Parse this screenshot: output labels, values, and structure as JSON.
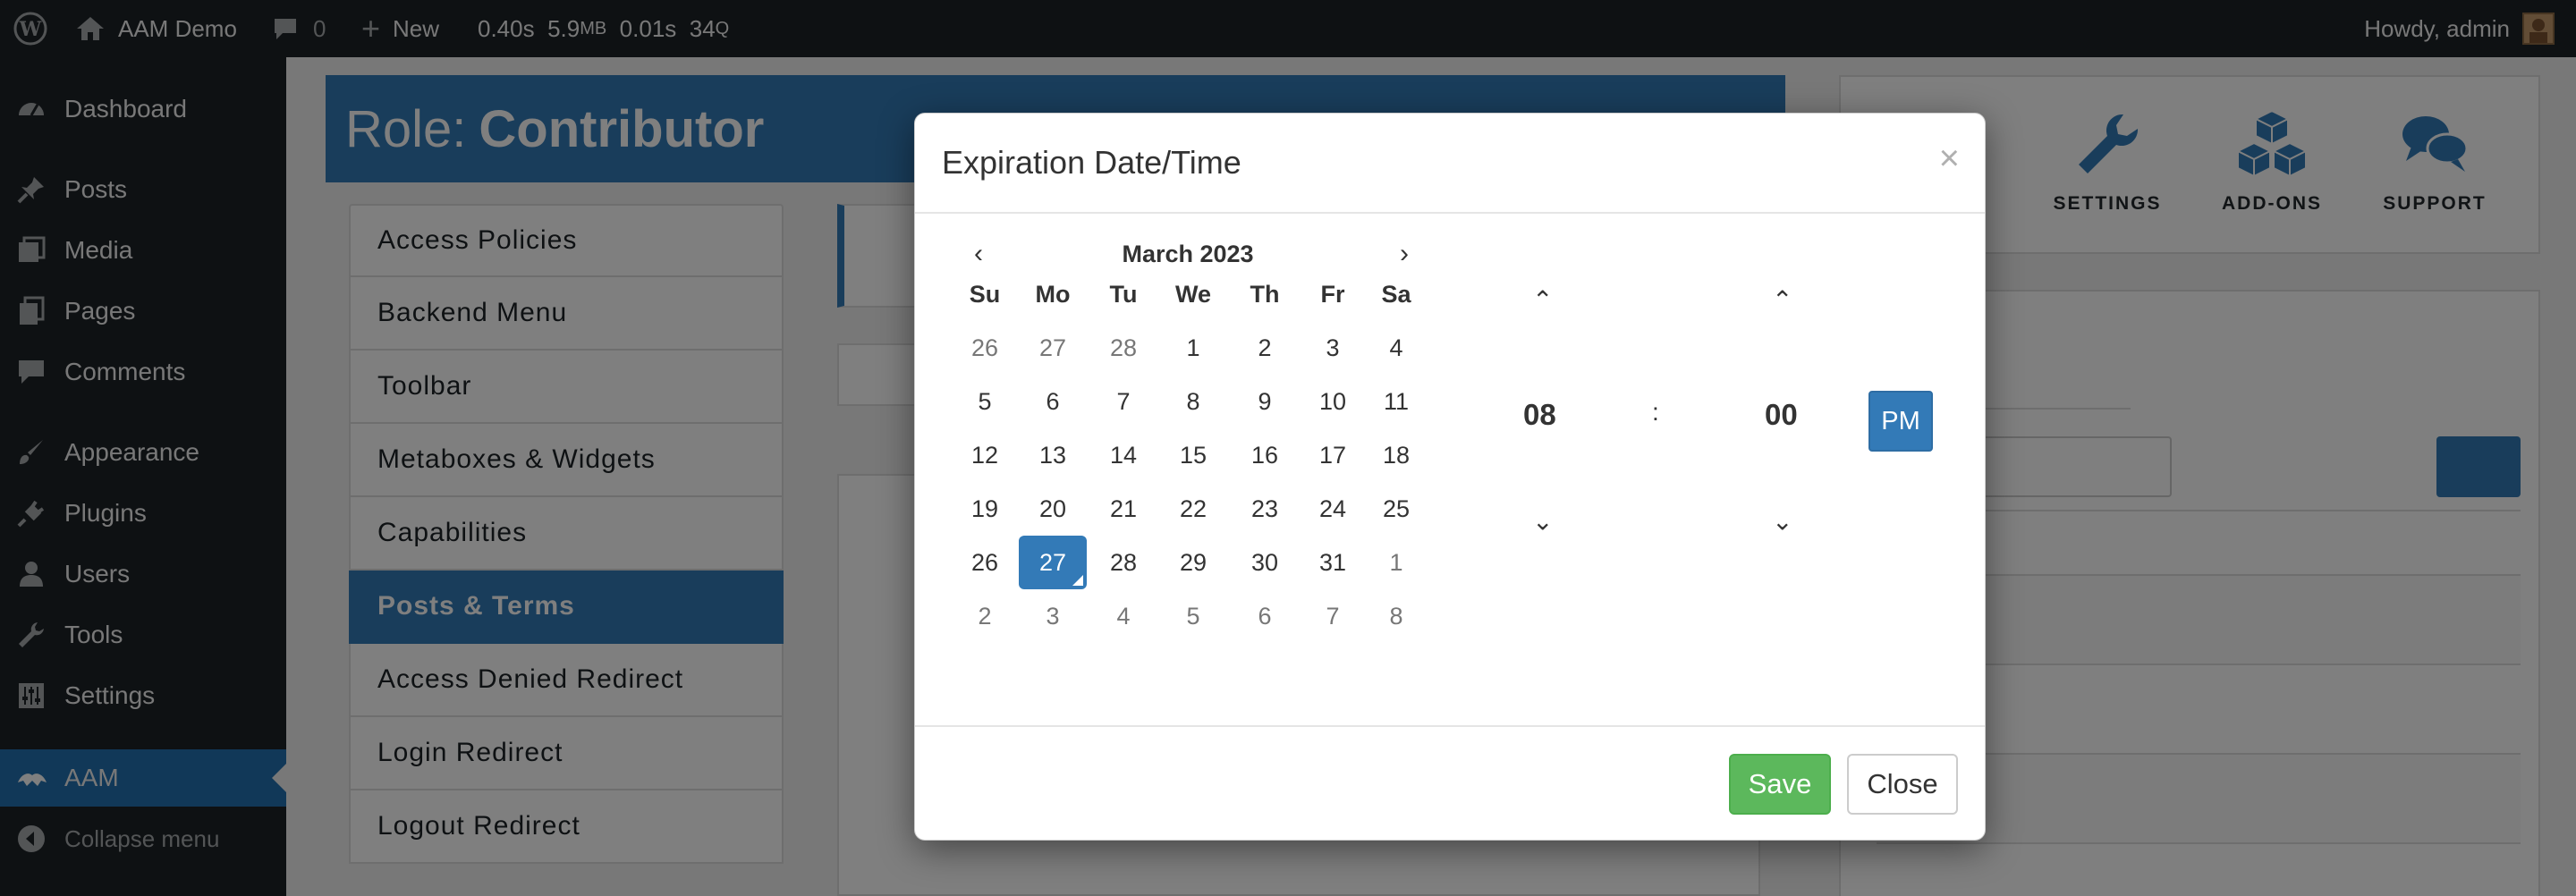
{
  "adminbar": {
    "site_name": "AAM Demo",
    "comments_count": "0",
    "new_label": "New",
    "stats": [
      "0.40s",
      "5.9",
      "MB",
      "0.01s",
      "34",
      "Q"
    ],
    "howdy": "Howdy, admin"
  },
  "sidebar": {
    "items": [
      {
        "label": "Dashboard",
        "icon": "dashboard-icon"
      },
      {
        "label": "Posts",
        "icon": "pin-icon"
      },
      {
        "label": "Media",
        "icon": "media-icon"
      },
      {
        "label": "Pages",
        "icon": "pages-icon"
      },
      {
        "label": "Comments",
        "icon": "comment-icon"
      },
      {
        "label": "Appearance",
        "icon": "brush-icon"
      },
      {
        "label": "Plugins",
        "icon": "plug-icon"
      },
      {
        "label": "Users",
        "icon": "user-icon"
      },
      {
        "label": "Tools",
        "icon": "wrench-icon"
      },
      {
        "label": "Settings",
        "icon": "sliders-icon"
      },
      {
        "label": "AAM",
        "icon": "aam-icon"
      },
      {
        "label": "Collapse menu",
        "icon": "collapse-icon"
      }
    ]
  },
  "role_header": {
    "prefix": "Role:",
    "name": "Contributor"
  },
  "left_menu": [
    "Access Policies",
    "Backend Menu",
    "Toolbar",
    "Metaboxes & Widgets",
    "Capabilities",
    "Posts & Terms",
    "Access Denied Redirect",
    "Login Redirect",
    "Logout Redirect"
  ],
  "tools": [
    {
      "label": "SETTINGS",
      "icon": "wrench-icon"
    },
    {
      "label": "ADD-ONS",
      "icon": "cubes-icon"
    },
    {
      "label": "SUPPORT",
      "icon": "chat-icon"
    }
  ],
  "colors": {
    "primary": "#337ab7",
    "success": "#5cb85c",
    "admin_bar": "#1d2327"
  },
  "modal": {
    "title": "Expiration Date/Time",
    "close_glyph": "×",
    "calendar": {
      "month": "March 2023",
      "prev": "‹",
      "next": "›",
      "dow": [
        "Su",
        "Mo",
        "Tu",
        "We",
        "Th",
        "Fr",
        "Sa"
      ],
      "weeks": [
        [
          "26",
          "27",
          "28",
          "1",
          "2",
          "3",
          "4"
        ],
        [
          "5",
          "6",
          "7",
          "8",
          "9",
          "10",
          "11"
        ],
        [
          "12",
          "13",
          "14",
          "15",
          "16",
          "17",
          "18"
        ],
        [
          "19",
          "20",
          "21",
          "22",
          "23",
          "24",
          "25"
        ],
        [
          "26",
          "27",
          "28",
          "29",
          "30",
          "31",
          "1"
        ],
        [
          "2",
          "3",
          "4",
          "5",
          "6",
          "7",
          "8"
        ]
      ],
      "selected": "27"
    },
    "time": {
      "hour": "08",
      "separator": ":",
      "minute": "00",
      "period": "PM"
    },
    "save_label": "Save",
    "close_label": "Close"
  }
}
